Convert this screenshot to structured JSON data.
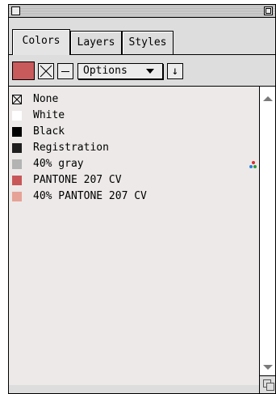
{
  "window": {
    "close_icon": "close-box-icon",
    "zoom_icon": "zoom-box-icon"
  },
  "tabs": [
    {
      "label": "Colors",
      "active": true
    },
    {
      "label": "Layers",
      "active": false
    },
    {
      "label": "Styles",
      "active": false
    }
  ],
  "toolbar": {
    "current_color": "#c85a5c",
    "none_icon": "none-x-icon",
    "remove_icon": "minus-icon",
    "options_label": "Options",
    "sort_label": "↓"
  },
  "swatches": [
    {
      "name": "None",
      "color": "none",
      "icon": "none-x-icon"
    },
    {
      "name": "White",
      "color": "#ffffff"
    },
    {
      "name": "Black",
      "color": "#000000"
    },
    {
      "name": "Registration",
      "color": "#1e1e1e"
    },
    {
      "name": "40% gray",
      "color": "#b3b3b3",
      "process_icon": "cmyk-process-icon"
    },
    {
      "name": "PANTONE 207 CV",
      "color": "#c8575a"
    },
    {
      "name": "40% PANTONE 207 CV",
      "color": "#e6a296"
    }
  ],
  "scrollbar": {
    "up_icon": "scroll-up-arrow-icon",
    "down_icon": "scroll-down-arrow-icon",
    "resize_icon": "resize-grip-icon"
  }
}
